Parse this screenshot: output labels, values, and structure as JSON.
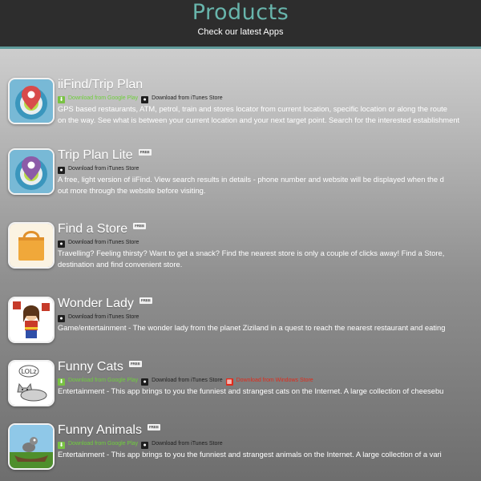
{
  "header": {
    "title": "Products",
    "subtitle": "Check our latest Apps"
  },
  "labels": {
    "google_play": "Download from Google Play",
    "itunes": "Download from iTunes Store",
    "windows": "Download from Windows Store",
    "free_badge": "FREE"
  },
  "colors": {
    "title_teal": "#68b5ac",
    "header_bg": "#2d2d2d",
    "google_play_green": "#6fcf3c",
    "windows_red": "#e02a1a"
  },
  "products": [
    {
      "name": "iiFind/Trip Plan",
      "icon": "map-pin-icon",
      "free": false,
      "stores": [
        "google_play",
        "itunes"
      ],
      "description": "GPS based restaurants, ATM, petrol, train and stores locator from current location, specific location or along the route\non the way. See what is between your current location and your next target point. Search for the interested establishment"
    },
    {
      "name": "Trip Plan Lite",
      "icon": "map-pin-icon",
      "free": true,
      "stores": [
        "itunes"
      ],
      "description": "A free, light version of iiFind. View search results in details - phone number and website will be displayed when the d\nout more through the website before visiting."
    },
    {
      "name": "Find a Store",
      "icon": "shopping-bag-icon",
      "free": true,
      "stores": [
        "itunes"
      ],
      "description": "Travelling? Feeling thirsty? Want to get a snack? Find the nearest store is only a couple of clicks away! Find a Store,\ndestination and find convenient store."
    },
    {
      "name": "Wonder Lady",
      "icon": "wonder-lady-icon",
      "free": true,
      "stores": [
        "itunes"
      ],
      "description": "Game/entertainment - The wonder lady from the planet Ziziland in a quest to reach the nearest restaurant and eating"
    },
    {
      "name": "Funny Cats",
      "icon": "cat-icon",
      "free": true,
      "stores": [
        "google_play",
        "itunes",
        "windows"
      ],
      "description": "Entertainment - This app brings to you the funniest and strangest cats on the Internet. A large collection of cheesebu"
    },
    {
      "name": "Funny Animals",
      "icon": "animal-icon",
      "free": true,
      "stores": [
        "google_play",
        "itunes"
      ],
      "description": "Entertainment - This app brings to you the funniest and strangest animals on the Internet. A large collection of a vari"
    }
  ]
}
